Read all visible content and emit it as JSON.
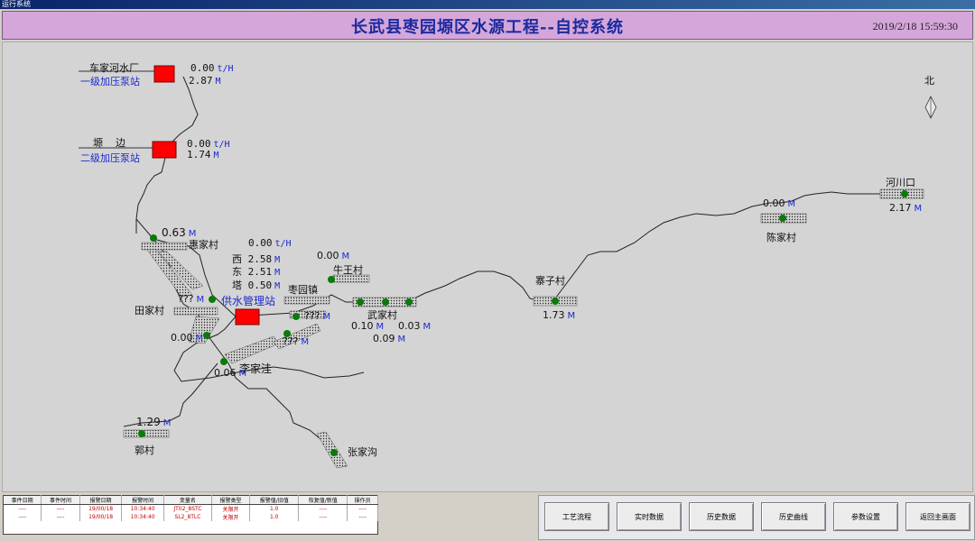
{
  "os_window_title": "运行系统",
  "header": {
    "title": "长武县枣园塬区水源工程--自控系统",
    "datetime": "2019/2/18 15:59:30"
  },
  "compass": {
    "label": "北"
  },
  "stations": {
    "chejia": {
      "name": "车家河水厂",
      "subtitle": "一级加压泵站",
      "flow": "0.00",
      "flow_unit": "t/H",
      "level": "2.87",
      "level_unit": "M"
    },
    "yuanbian": {
      "name": "塬    边",
      "subtitle": "二级加压泵站",
      "flow": "0.00",
      "flow_unit": "t/H",
      "level": "1.74",
      "level_unit": "M"
    },
    "gongshui": {
      "name": "供水管理站",
      "flow": "0.00",
      "flow_unit": "t/H",
      "west_label": "西",
      "west": "2.58",
      "east_label": "东",
      "east": "2.51",
      "tower_label": "塔",
      "tower": "0.50",
      "unit": "M"
    }
  },
  "villages": {
    "huijia": {
      "name": "惠家村",
      "value": "0.63",
      "unit": "M"
    },
    "tianjia": {
      "name": "田家村",
      "value": "???",
      "unit": "M"
    },
    "lijiawa": {
      "name": "李家洼",
      "value": "0.06",
      "unit": "M",
      "value2": "0.00",
      "unit2": "M"
    },
    "zaoyuan": {
      "name": "枣园镇",
      "value": "???",
      "unit": "M",
      "value2": "???",
      "unit2": "M"
    },
    "niuwang": {
      "name": "牛王村",
      "value": "0.00",
      "unit": "M"
    },
    "wujia": {
      "name": "武家村",
      "value_a": "0.10",
      "value_b": "0.09",
      "value_c": "0.03",
      "unit": "M"
    },
    "zhaizi": {
      "name": "寨子村",
      "value": "1.73",
      "unit": "M"
    },
    "chenjia": {
      "name": "陈家村",
      "value": "0.00",
      "unit": "M"
    },
    "hechuankou": {
      "name": "河川口",
      "value": "2.17",
      "unit": "M"
    },
    "guocun": {
      "name": "郭村",
      "value": "1.29",
      "unit": "M"
    },
    "zhangjiagou": {
      "name": "张家沟"
    }
  },
  "alarm_table": {
    "headers": [
      "事件日期",
      "事件时间",
      "报警日期",
      "报警时间",
      "变量名",
      "报警类型",
      "报警值/旧值",
      "恢复值/新值",
      "操作员"
    ],
    "rows": [
      [
        "----",
        "----",
        "19/00/18",
        "10:34:40",
        "JT02_8STC",
        "关限开",
        "1.0",
        "----",
        "----"
      ],
      [
        "----",
        "----",
        "19/00/18",
        "10:34:40",
        "SL2_8TLC",
        "关限开",
        "1.0",
        "----",
        "----"
      ]
    ]
  },
  "buttons": [
    "工艺流程",
    "实时数据",
    "历史数据",
    "历史曲线",
    "参数设置",
    "返回主画面"
  ],
  "colors": {
    "header_bg": "#d5a6d9",
    "title": "#1a2aa0",
    "pump": "#ff0000",
    "node": "#0a7a0a",
    "unit": "#1a2ad0"
  }
}
